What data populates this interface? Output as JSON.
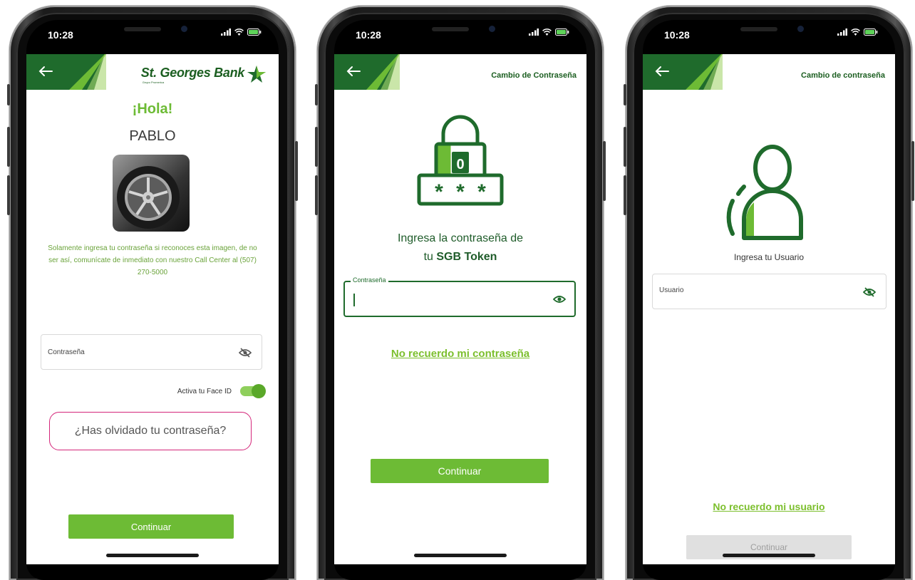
{
  "status_bar": {
    "time": "10:28"
  },
  "colors": {
    "brand_green": "#1b6b2c",
    "accent_green": "#6dbb35",
    "highlight_pink": "#d4267a",
    "disabled_gray": "#e0e0e0"
  },
  "screen1": {
    "brand": "St. Georges Bank",
    "brand_sub": "Grupo Promerica",
    "greeting": "¡Hola!",
    "username": "PABLO",
    "security_text": "Solamente ingresa tu contraseña si reconoces esta imagen, de no ser así, comunícate de inmediato con nuestro Call Center al (507) 270-5000",
    "password_placeholder": "Contraseña",
    "faceid_label": "Activa tu Face ID",
    "forgot": "¿Has olvidado tu contraseña?",
    "continue": "Continuar",
    "security_image_icon": "car-wheel-icon"
  },
  "screen2": {
    "title": "Cambio de Contraseña",
    "prompt_line1": "Ingresa la contraseña de",
    "prompt_line2_prefix": "tu ",
    "prompt_line2_bold": "SGB Token",
    "field_label": "Contraseña",
    "forgot_link": "No recuerdo mi contraseña",
    "continue": "Continuar",
    "lock_digit": "0",
    "icon": "lock-password-icon"
  },
  "screen3": {
    "title": "Cambio de contraseña",
    "prompt": "Ingresa tu Usuario",
    "field_placeholder": "Usuario",
    "forgot_link": "No recuerdo mi usuario",
    "continue": "Continuar",
    "icon": "user-icon"
  }
}
